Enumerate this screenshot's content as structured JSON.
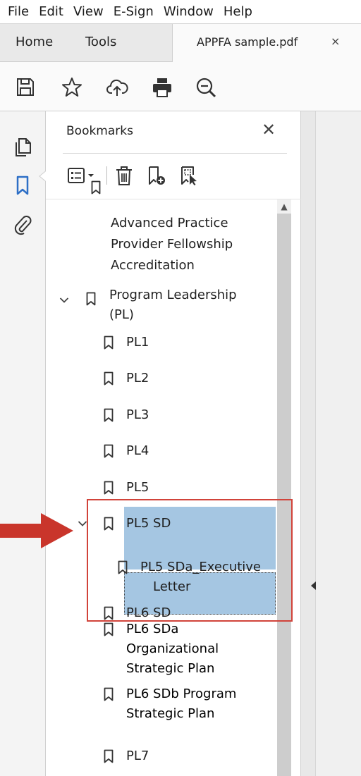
{
  "menubar": {
    "items": [
      "File",
      "Edit",
      "View",
      "E-Sign",
      "Window",
      "Help"
    ]
  },
  "tabs": {
    "home": "Home",
    "tools": "Tools",
    "document": "APPFA sample.pdf",
    "close": "×"
  },
  "toolbar": {
    "icons": [
      "save-icon",
      "bookmark-star-icon",
      "cloud-upload-icon",
      "print-icon",
      "zoom-out-icon"
    ]
  },
  "rail": {
    "icons": [
      "page-thumbnails-icon",
      "bookmarks-icon",
      "attachments-icon"
    ],
    "active": "bookmarks-icon"
  },
  "panel": {
    "title": "Bookmarks",
    "close": "✕",
    "toolbar_icons": [
      "options-menu-icon",
      "delete-bookmark-icon",
      "new-bookmark-icon",
      "bookmark-from-selection-icon"
    ]
  },
  "bookmarks": [
    {
      "lines": [
        "Advanced Practice",
        "Provider Fellowship",
        "Accreditation"
      ],
      "level": 0,
      "expanded": null,
      "selected": false
    },
    {
      "lines": [
        "Program Leadership",
        "(PL)"
      ],
      "level": 0,
      "expanded": true,
      "selected": false
    },
    {
      "lines": [
        "PL1"
      ],
      "level": 1,
      "expanded": null,
      "selected": false
    },
    {
      "lines": [
        "PL2"
      ],
      "level": 1,
      "expanded": null,
      "selected": false
    },
    {
      "lines": [
        "PL3"
      ],
      "level": 1,
      "expanded": null,
      "selected": false
    },
    {
      "lines": [
        "PL4"
      ],
      "level": 1,
      "expanded": null,
      "selected": false
    },
    {
      "lines": [
        "PL5"
      ],
      "level": 1,
      "expanded": null,
      "selected": false
    },
    {
      "lines": [
        "PL5 SD"
      ],
      "level": 1,
      "expanded": true,
      "selected": false
    },
    {
      "lines": [
        "PL5 SDa_Executive",
        "Letter"
      ],
      "level": 2,
      "expanded": null,
      "selected": false
    },
    {
      "lines": [
        "PL6 SD"
      ],
      "level": 1,
      "expanded": null,
      "selected": false
    },
    {
      "lines": [
        "PL6 SDa",
        "Organizational",
        "Strategic Plan"
      ],
      "level": 1,
      "expanded": null,
      "selected": true
    },
    {
      "lines": [
        "PL6 SDb Program",
        "Strategic Plan"
      ],
      "level": 1,
      "expanded": null,
      "selected": true
    },
    {
      "lines": [
        "PL7"
      ],
      "level": 1,
      "expanded": null,
      "selected": false
    }
  ],
  "colors": {
    "selection": "#a5c6e2",
    "highlight_box": "#d1433a",
    "annotation_arrow": "#c9352b",
    "active_rail_icon": "#2d6fc6"
  }
}
